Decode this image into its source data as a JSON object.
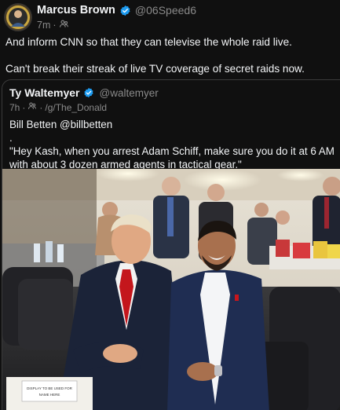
{
  "post": {
    "author_name": "Marcus Brown",
    "handle": "@06Speed6",
    "time": "7m",
    "dot": "·",
    "paragraphs": [
      "And inform CNN so that they can televise the whole raid live.",
      "Can't break their streak of live TV coverage of secret raids now."
    ]
  },
  "quoted": {
    "author_name": "Ty Waltemyer",
    "handle": "@waltemyer",
    "time": "7h",
    "dot": "·",
    "community": "/g/The_Donald",
    "lines": [
      "Bill Betten @billbetten",
      ".",
      "\"Hey Kash, when you arrest Adam Schiff, make sure you do it at 6 AM with about 3 dozen armed agents in tactical gear.\""
    ],
    "photo_card_text": "DISPLAY TO BE USED FOR",
    "photo_card_text_2": "NAME HERE"
  },
  "colors": {
    "background": "#101010",
    "text_primary": "#f3f5f7",
    "text_secondary": "#8a8a8a",
    "verified_blue": "#1d9bf0",
    "border": "#3a3a3a"
  },
  "icons": [
    "verified-badge-icon",
    "community-icon"
  ]
}
